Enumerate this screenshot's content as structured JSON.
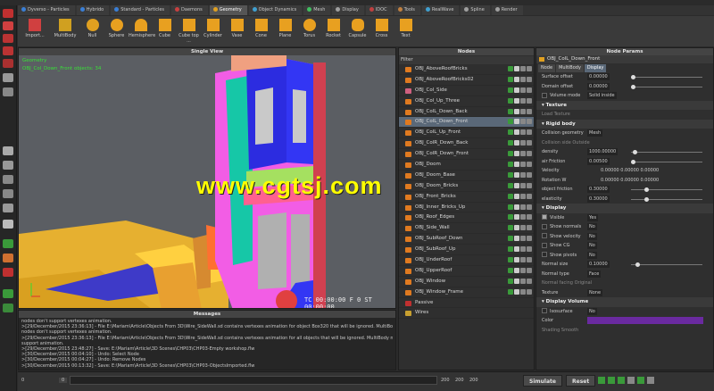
{
  "tabs": [
    {
      "label": "Dyverso - Particles",
      "color": "#3a7fd6"
    },
    {
      "label": "Hybrido",
      "color": "#3a7fd6"
    },
    {
      "label": "Standard - Particles",
      "color": "#3a7fd6"
    },
    {
      "label": "Daemons",
      "color": "#c84040"
    },
    {
      "label": "Geometry",
      "color": "#e0a020",
      "active": true
    },
    {
      "label": "Object Dynamics",
      "color": "#40a0d0"
    },
    {
      "label": "Mesh",
      "color": "#40c060"
    },
    {
      "label": "Display",
      "color": "#a0a0a0"
    },
    {
      "label": "IDOC",
      "color": "#c04040"
    },
    {
      "label": "Tools",
      "color": "#c08040"
    },
    {
      "label": "RealWave",
      "color": "#40a0d0"
    },
    {
      "label": "Spline",
      "color": "#a0a0a0"
    },
    {
      "label": "Render",
      "color": "#a0a0a0"
    }
  ],
  "shelf": [
    {
      "label": "Import...",
      "icon": "import-icon",
      "color": "#d04040"
    },
    {
      "label": "MultiBody",
      "icon": "multibody-icon",
      "color": "#d0a020"
    },
    {
      "label": "Null",
      "icon": "null-icon",
      "color": "#e0a020"
    },
    {
      "label": "Sphere",
      "icon": "sphere-icon",
      "color": "#e8a020"
    },
    {
      "label": "Hemisphere",
      "icon": "hemisphere-icon",
      "color": "#e8a020"
    },
    {
      "label": "Cube",
      "icon": "cube-icon",
      "color": "#e8a020"
    },
    {
      "label": "Cube top ...",
      "icon": "cube-top-icon",
      "color": "#e8a020"
    },
    {
      "label": "Cylinder",
      "icon": "cylinder-icon",
      "color": "#e8a020"
    },
    {
      "label": "Vase",
      "icon": "vase-icon",
      "color": "#e8a020"
    },
    {
      "label": "Cone",
      "icon": "cone-icon",
      "color": "#e8a020"
    },
    {
      "label": "Plane",
      "icon": "plane-icon",
      "color": "#e8a020"
    },
    {
      "label": "Torus",
      "icon": "torus-icon",
      "color": "#e8a020"
    },
    {
      "label": "Rocket",
      "icon": "rocket-icon",
      "color": "#e8a020"
    },
    {
      "label": "Capsule",
      "icon": "capsule-icon",
      "color": "#e8a020"
    },
    {
      "label": "Cross",
      "icon": "cross-icon",
      "color": "#e8a020"
    },
    {
      "label": "Text",
      "icon": "text-icon",
      "color": "#e8a020"
    }
  ],
  "viewport": {
    "title": "Single View",
    "info_line1": "Geometry",
    "info_line2": "OBJ_Col_Down_Front objects: 34",
    "timecode": "TC 00:00:00   F 0   ST 00:00:00",
    "watermark": "www.cgtsj.com"
  },
  "messages": {
    "title": "Messages",
    "lines": [
      "nodes don't support vertexes animation.",
      ">[29/December/2015 23:36:13] - File E:\\Mariam\\Article\\Objects From 3D\\Wire_SideWall.sd contains vertexes animation for object Box320 that will be ignored. MultiBody",
      "nodes don't support vertexes animation.",
      ">[29/December/2015 23:36:13] - File E:\\Mariam\\Article\\Objects From 3D\\Wire_SideWall.sd contains vertexes animation for all objects that will be ignored. MultiBody nodes don't",
      "support animation.",
      ">[29/December/2015 23:48:27] - Save: E:\\Mariam\\Article\\3D Scenes\\CHP03\\CHP03-Empty workshop.flw",
      ">[30/December/2015 00:04:10] - Undo: Select Node",
      ">[30/December/2015 00:04:27] - Undo: Remove Nodes",
      ">[30/December/2015 00:13:32] - Save: E:\\Mariam\\Article\\3D Scenes\\CHP03\\CHP03-ObjectsImported.flw"
    ]
  },
  "timeline": {
    "start": "0",
    "current": "0",
    "end": "200",
    "end2": "200",
    "end3": "200"
  },
  "buttons": {
    "simulate": "Simulate",
    "reset": "Reset"
  },
  "nodes": {
    "title": "Nodes",
    "filter": "Filter",
    "items": [
      "OBJ_AboveRoofBricks",
      "OBJ_AboveRoofBricks02",
      "OBJ_Col_Side",
      "OBJ_Col_Up_Three",
      "OBJ_ColL_Down_Back",
      "OBJ_ColL_Down_Front",
      "OBJ_ColL_Up_Front",
      "OBJ_ColR_Down_Back",
      "OBJ_ColR_Down_Front",
      "OBJ_Doom",
      "OBJ_Doom_Base",
      "OBJ_Doom_Bricks",
      "OBJ_Front_Bricks",
      "OBJ_Inner_Bricks_Up",
      "OBJ_Roof_Edges",
      "OBJ_Side_Wall",
      "OBJ_SubRoof_Down",
      "OBJ_SubRoof_Up",
      "OBJ_UnderRoof",
      "OBJ_UpperRoof",
      "OBJ_Window",
      "OBJ_Window_Frame",
      "Passive",
      "Wires"
    ],
    "selected": 5
  },
  "params": {
    "title": "Node Params",
    "node_name": "OBJ_ColL_Down_Front",
    "tabs": [
      "Node",
      "MultiBody",
      "Display"
    ],
    "rows": [
      {
        "kind": "field",
        "label": "Surface offset",
        "value": "0.00000"
      },
      {
        "kind": "field",
        "label": "Domain offset",
        "value": "0.00000"
      },
      {
        "kind": "check",
        "label": "Volume mode",
        "value": "Solid inside"
      },
      {
        "kind": "section",
        "label": "Texture"
      },
      {
        "kind": "plain",
        "label": "Load Texture"
      },
      {
        "kind": "section",
        "label": "Rigid body"
      },
      {
        "kind": "field",
        "label": "Collision geometry",
        "value": "Mesh"
      },
      {
        "kind": "plain",
        "label": "Collision side    Outside"
      },
      {
        "kind": "field",
        "label": "density",
        "value": "1000.00000"
      },
      {
        "kind": "field",
        "label": "air Friction",
        "value": "0.00500"
      },
      {
        "kind": "vec",
        "label": "Velocity",
        "value": "0.00000    0.00000    0.00000"
      },
      {
        "kind": "vec",
        "label": "Rotation W",
        "value": "0.00000    0.00000    0.00000"
      },
      {
        "kind": "field",
        "label": "object friction",
        "value": "0.30000"
      },
      {
        "kind": "field",
        "label": "elasticity",
        "value": "0.30000"
      },
      {
        "kind": "section",
        "label": "Display"
      },
      {
        "kind": "check",
        "label": "Visible",
        "value": "Yes",
        "on": true
      },
      {
        "kind": "check",
        "label": "Show normals",
        "value": "No"
      },
      {
        "kind": "check",
        "label": "Show velocity",
        "value": "No"
      },
      {
        "kind": "check",
        "label": "Show CG",
        "value": "No"
      },
      {
        "kind": "check",
        "label": "Show pivots",
        "value": "No"
      },
      {
        "kind": "field",
        "label": "Normal size",
        "value": "0.10000"
      },
      {
        "kind": "field",
        "label": "Normal type",
        "value": "Face"
      },
      {
        "kind": "plain",
        "label": "Normal facing    Original"
      },
      {
        "kind": "field",
        "label": "Texture",
        "value": "None"
      },
      {
        "kind": "section",
        "label": "Display Volume"
      },
      {
        "kind": "check",
        "label": "Isosurface",
        "value": "No"
      },
      {
        "kind": "color",
        "label": "Color",
        "value": "#6a2aa0"
      },
      {
        "kind": "plain",
        "label": "Shading    Smooth"
      }
    ]
  }
}
